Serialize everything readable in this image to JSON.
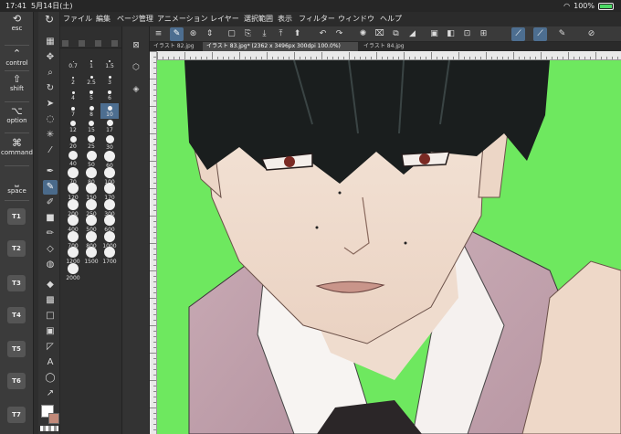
{
  "status": {
    "time": "17:41",
    "date": "5月14日(土)",
    "battery": "100%"
  },
  "modifiers": [
    {
      "label": "esc",
      "icon": "undo-icon"
    },
    {
      "label": "control",
      "icon": "up-arrow-icon"
    },
    {
      "label": "shift",
      "icon": "shift-icon"
    },
    {
      "label": "option",
      "icon": "option-icon"
    },
    {
      "label": "command",
      "icon": "command-icon"
    },
    {
      "label": "space",
      "icon": "space-icon"
    }
  ],
  "tkeys": [
    "T1",
    "T2",
    "T3",
    "T4",
    "T5",
    "T6",
    "T7"
  ],
  "menu": [
    "ファイル",
    "編集",
    "ページ管理",
    "アニメーション",
    "レイヤー",
    "選択範囲",
    "表示",
    "フィルター",
    "ウィンドウ",
    "ヘルプ"
  ],
  "tabs": [
    {
      "label": "イラスト 82.jpg",
      "active": false
    },
    {
      "label": "イラスト 83.jpg* (2362 x 3496px 300dpi 100.0%)",
      "active": true
    },
    {
      "label": "イラスト 84.jpg",
      "active": false
    }
  ],
  "brush_sizes": [
    "0.7",
    "1",
    "1.5",
    "2",
    "2.5",
    "3",
    "4",
    "5",
    "6",
    "7",
    "8",
    "10",
    "12",
    "15",
    "17",
    "20",
    "25",
    "30",
    "40",
    "50",
    "60",
    "70",
    "80",
    "100",
    "120",
    "150",
    "170",
    "200",
    "250",
    "300",
    "400",
    "500",
    "600",
    "700",
    "800",
    "1000",
    "1200",
    "1500",
    "1700",
    "2000"
  ],
  "selected_brush_size": "10",
  "colors": {
    "main": "#ffffff",
    "sub": "#c28a7a",
    "canvas_bg": "#6ee85f"
  }
}
